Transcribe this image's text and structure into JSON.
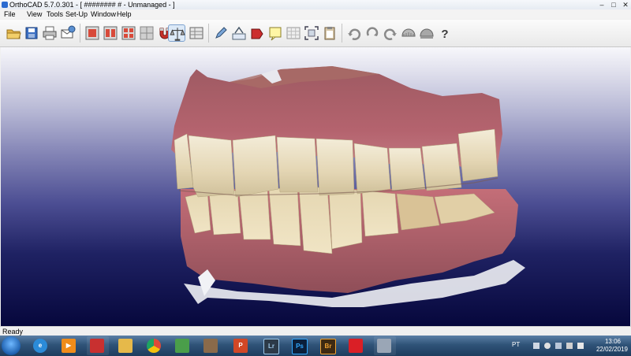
{
  "window": {
    "title": "OrthoCAD 5.7.0.301 - [ ######## # - Unmanaged - ]",
    "controls": {
      "minimize": "–",
      "maximize": "□",
      "close": "✕"
    }
  },
  "menu": [
    "File",
    "View",
    "Tools",
    "Set-Up",
    "Window",
    "Help"
  ],
  "toolbar": {
    "groups": [
      [
        "open-folder-icon",
        "save-icon",
        "print-icon",
        "email-icon"
      ],
      [
        "model-view-1-icon",
        "model-view-2-icon",
        "model-view-3-icon",
        "model-view-4-icon",
        "magnet-icon",
        "occlusion-analysis-icon",
        "measure-table-icon"
      ],
      [
        "tool-pen-icon",
        "abc-label-icon",
        "red-pointer-icon",
        "note-icon",
        "grid-icon",
        "fit-frame-icon",
        "clipboard-icon"
      ],
      [
        "rotate-left-icon",
        "rotate-center-icon",
        "rotate-right-icon",
        "jaw-upper-icon",
        "jaw-lower-icon",
        "help-icon"
      ]
    ],
    "active": "occlusion-analysis-icon"
  },
  "status": {
    "text": "Ready"
  },
  "taskbar": {
    "start": "windows-start-icon",
    "apps": [
      {
        "name": "internet-explorer-icon",
        "label": "e",
        "color": "#2b8bd8"
      },
      {
        "name": "media-player-icon",
        "label": "▶",
        "color": "#f08c1a"
      },
      {
        "name": "orthocad-tray-icon",
        "label": "",
        "color": "#c83030"
      },
      {
        "name": "file-explorer-icon",
        "label": "",
        "color": "#e6b94a"
      },
      {
        "name": "chrome-icon",
        "label": "",
        "color": "#dd4b39"
      },
      {
        "name": "green-app-icon",
        "label": "",
        "color": "#4a9e4a"
      },
      {
        "name": "paint-app-icon",
        "label": "",
        "color": "#8a6a4a"
      },
      {
        "name": "powerpoint-icon",
        "label": "P",
        "color": "#d24726"
      },
      {
        "name": "lightroom-icon",
        "label": "Lr",
        "color": "#2c3a48"
      },
      {
        "name": "photoshop-icon",
        "label": "Ps",
        "color": "#0b1f3a"
      },
      {
        "name": "bridge-icon",
        "label": "Br",
        "color": "#3d2a12"
      },
      {
        "name": "creative-cloud-icon",
        "label": "",
        "color": "#da1f26"
      },
      {
        "name": "orthocad-app-icon",
        "label": "",
        "color": "#9aa6b6"
      }
    ],
    "tray": {
      "language": "PT",
      "time": "13:06",
      "date": "22/02/2019"
    }
  },
  "colors": {
    "accent": "#3a6ea5",
    "viewport_top": "#f7f7fb",
    "viewport_bottom": "#06073c"
  }
}
